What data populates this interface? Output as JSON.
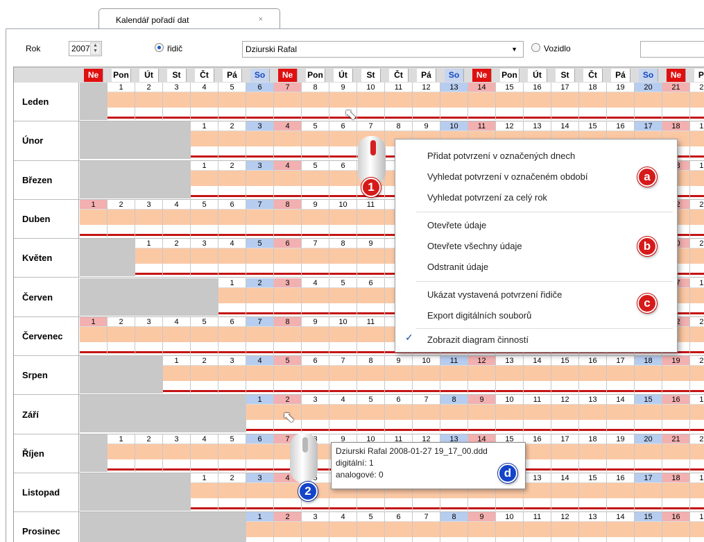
{
  "tab": {
    "title": "Kalendář pořadí dat",
    "close": "×"
  },
  "toolbar": {
    "year_label": "Rok",
    "year_value": "2007",
    "driver_label": "řidič",
    "driver_value": "Dziurski Rafal",
    "vehicle_label": "Vozidlo"
  },
  "day_headers": [
    "Ne",
    "Pon",
    "Út",
    "St",
    "Čt",
    "Pá",
    "So",
    "Ne",
    "Pon",
    "Út",
    "St",
    "Čt",
    "Pá",
    "So",
    "Ne",
    "Pon",
    "Út",
    "St",
    "Čt",
    "Pá",
    "So",
    "Ne",
    "Po"
  ],
  "months": [
    {
      "name": "Leden",
      "start": 1,
      "days": 22
    },
    {
      "name": "Únor",
      "start": 4,
      "days": 19
    },
    {
      "name": "Březen",
      "start": 4,
      "days": 19
    },
    {
      "name": "Duben",
      "start": 0,
      "days": 23
    },
    {
      "name": "Květen",
      "start": 2,
      "days": 21
    },
    {
      "name": "Červen",
      "start": 5,
      "days": 18
    },
    {
      "name": "Červenec",
      "start": 0,
      "days": 23
    },
    {
      "name": "Srpen",
      "start": 3,
      "days": 20
    },
    {
      "name": "Září",
      "start": 6,
      "days": 17
    },
    {
      "name": "Říjen",
      "start": 1,
      "days": 22
    },
    {
      "name": "Listopad",
      "start": 4,
      "days": 19
    },
    {
      "name": "Prosinec",
      "start": 6,
      "days": 17
    }
  ],
  "context_menu": {
    "items": [
      "Přidat potvrzení v označených dnech",
      "Vyhledat potvrzení v označeném období",
      "Vyhledat potvrzení za celý rok",
      "Otevřete údaje",
      "Otevřete všechny údaje",
      "Odstranit údaje",
      "Ukázat vystavená potvrzení řidiče",
      "Export digitálních souborů",
      "Zobrazit diagram činností"
    ],
    "check": "✓"
  },
  "badges": {
    "a": "a",
    "b": "b",
    "c": "c",
    "d": "d",
    "one": "1",
    "two": "2"
  },
  "tooltip": {
    "line1": "Dziurski Rafal 2008-01-27 19_17_00.ddd",
    "line2": "digitální: 1",
    "line3": "analogové: 0"
  },
  "colors": {
    "sunday": "#e01010",
    "saturday": "#1248c0",
    "activity": "#fbc8a4",
    "badge_red": "#d61a1a",
    "badge_blue": "#1444c8"
  }
}
